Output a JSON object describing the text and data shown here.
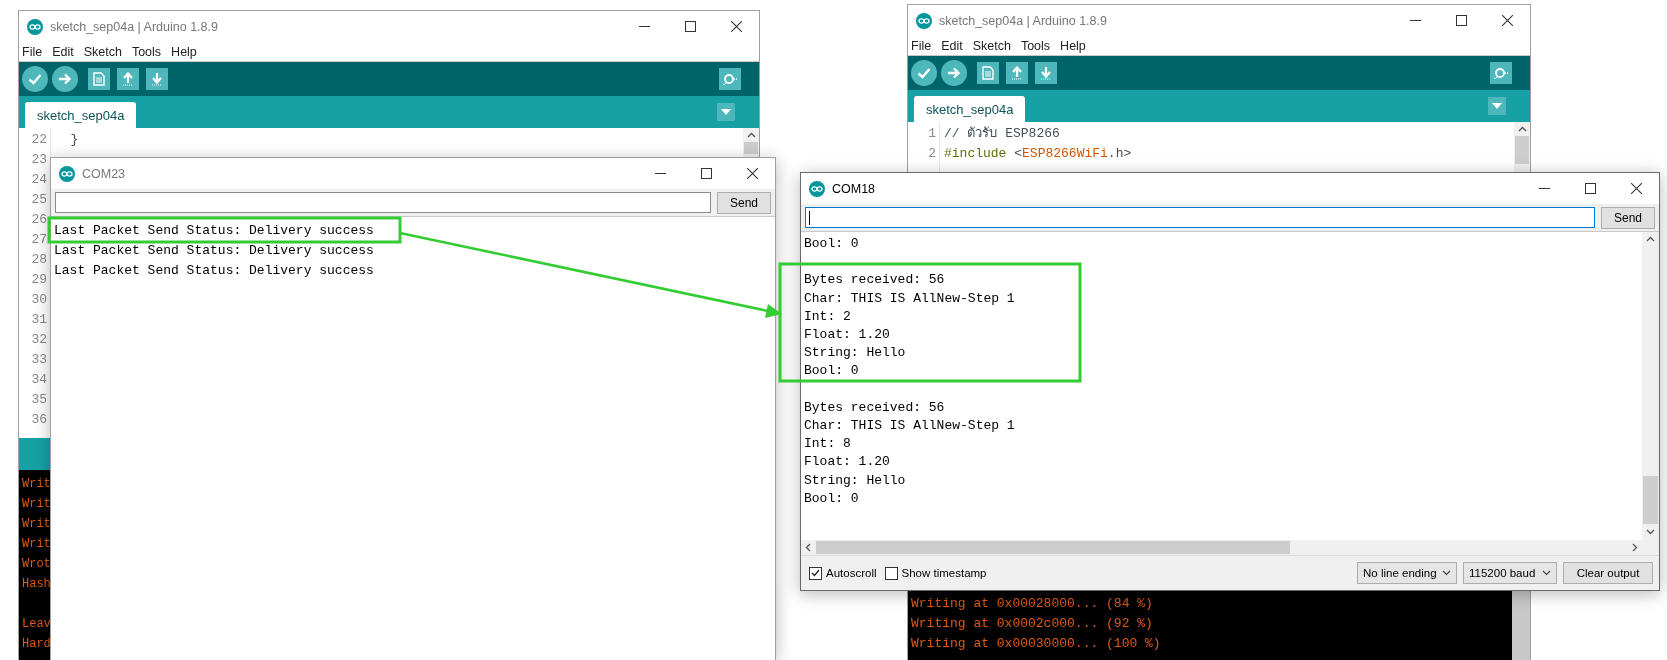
{
  "ide_windows": [
    {
      "title": "sketch_sep04a | Arduino 1.8.9",
      "menu": [
        "File",
        "Edit",
        "Sketch",
        "Tools",
        "Help"
      ],
      "tab": "sketch_sep04a",
      "code_lines": [
        {
          "number": "22",
          "segments": [
            {
              "text": "  }",
              "kind": "plain"
            }
          ]
        },
        {
          "number": "23"
        },
        {
          "number": "24"
        },
        {
          "number": "25"
        },
        {
          "number": "26"
        },
        {
          "number": "27"
        },
        {
          "number": "28"
        },
        {
          "number": "29"
        },
        {
          "number": "30"
        },
        {
          "number": "31"
        },
        {
          "number": "32"
        },
        {
          "number": "33"
        },
        {
          "number": "34"
        },
        {
          "number": "35"
        },
        {
          "number": "36"
        }
      ],
      "console_lines": [
        {
          "text": "Writ",
          "gap_before": false
        },
        {
          "text": "Writ",
          "gap_before": false
        },
        {
          "text": "Writ",
          "gap_before": false
        },
        {
          "text": "Writ",
          "gap_before": false
        },
        {
          "text": "Wrot",
          "gap_before": false
        },
        {
          "text": "Hash",
          "gap_before": false
        },
        {
          "text": "Leav",
          "gap_before": true
        },
        {
          "text": "Hard",
          "gap_before": false
        }
      ]
    },
    {
      "title": "sketch_sep04a | Arduino 1.8.9",
      "menu": [
        "File",
        "Edit",
        "Sketch",
        "Tools",
        "Help"
      ],
      "tab": "sketch_sep04a",
      "code_lines": [
        {
          "number": "1",
          "segments": [
            {
              "text": "// ตัวรับ ESP8266",
              "kind": "comment"
            }
          ]
        },
        {
          "number": "2",
          "segments": [
            {
              "text": "#include",
              "kind": "keyword"
            },
            {
              "text": " <",
              "kind": "plain"
            },
            {
              "text": "ESP8266WiFi",
              "kind": "library"
            },
            {
              "text": ".h>",
              "kind": "plain"
            }
          ]
        }
      ],
      "console_lines": [
        {
          "text": "Writing at 0x00028000... (84 %)",
          "gap_before": false
        },
        {
          "text": "Writing at 0x0002c000... (92 %)",
          "gap_before": false
        },
        {
          "text": "Writing at 0x00030000... (100 %)",
          "gap_before": false
        }
      ]
    }
  ],
  "serial_monitors": [
    {
      "title": "COM23",
      "active": false,
      "focused": false,
      "send": "Send",
      "output_blocks": [
        [
          "Last Packet Send Status: Delivery success",
          "Last Packet Send Status: Delivery success",
          "Last Packet Send Status: Delivery success"
        ]
      ]
    },
    {
      "title": "COM18",
      "active": true,
      "focused": true,
      "send": "Send",
      "output_blocks": [
        [
          "Bool: 0"
        ],
        [
          "Bytes received: 56",
          "Char: THIS IS AllNew-Step 1",
          "Int: 2",
          "Float: 1.20",
          "String: Hello",
          "Bool: 0"
        ],
        [
          "Bytes received: 56",
          "Char: THIS IS AllNew-Step 1",
          "Int: 8",
          "Float: 1.20",
          "String: Hello",
          "Bool: 0"
        ]
      ],
      "footer": {
        "autoscroll": {
          "label": "Autoscroll",
          "checked": true
        },
        "timestamp": {
          "label": "Show timestamp",
          "checked": false
        },
        "line_ending": "No line ending",
        "baud": "115200 baud",
        "clear": "Clear output"
      }
    }
  ]
}
